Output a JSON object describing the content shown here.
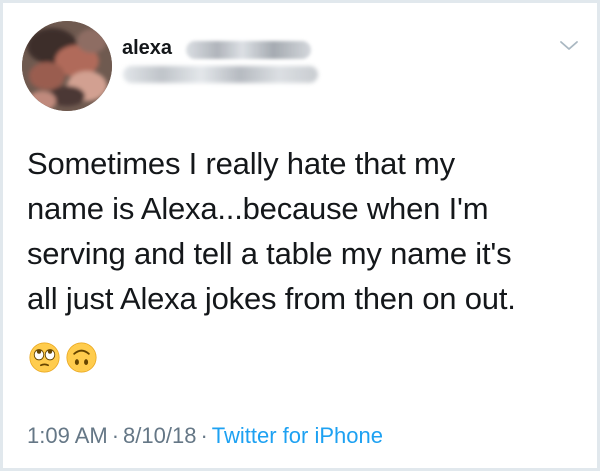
{
  "user": {
    "display_name": "alexa"
  },
  "tweet": {
    "lines": [
      "Sometimes I really hate that my",
      "name is Alexa...because when I'm",
      "serving and tell a table my name it's",
      "all just Alexa jokes from then on out."
    ],
    "emojis": [
      "🙄",
      "🙃"
    ],
    "time": "1:09 AM",
    "date": "8/10/18",
    "separator": "·",
    "source": "Twitter for iPhone"
  },
  "icons": {
    "menu": "chevron-down-icon",
    "emoji_1": "face-with-rolling-eyes-icon",
    "emoji_2": "upside-down-face-icon"
  },
  "colors": {
    "text": "#14171a",
    "meta": "#657786",
    "link": "#1da1f2",
    "border": "#e1e8ed"
  }
}
